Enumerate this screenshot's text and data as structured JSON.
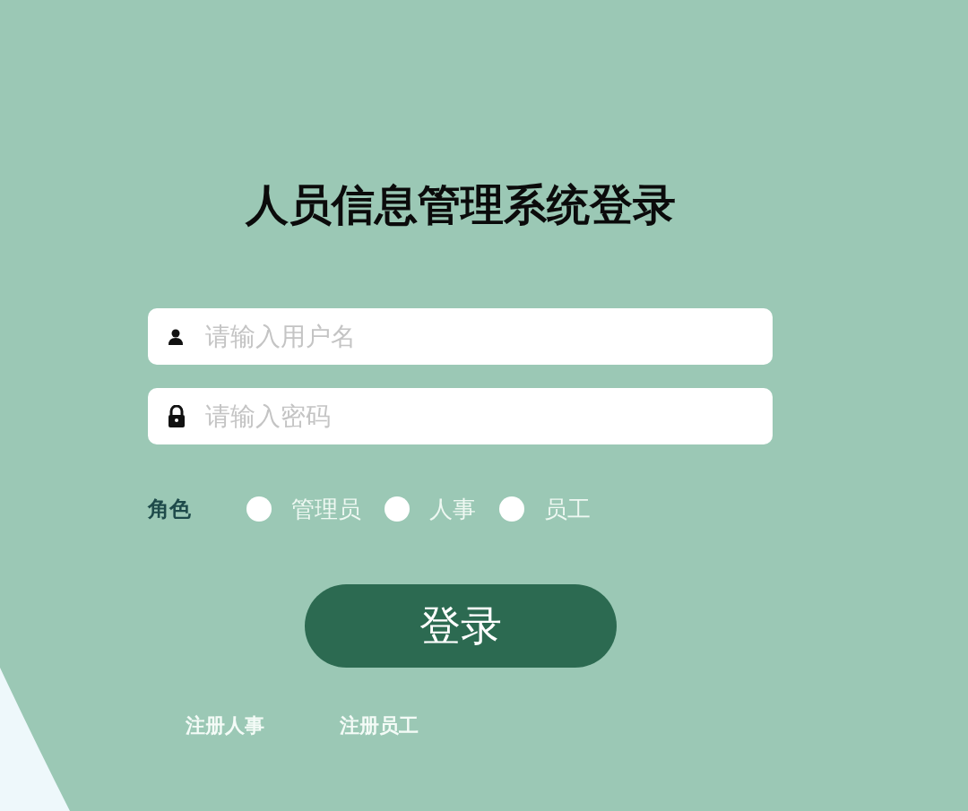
{
  "title": "人员信息管理系统登录",
  "fields": [
    {
      "kind": "user",
      "placeholder": "请输入用户名"
    },
    {
      "kind": "password",
      "placeholder": "请输入密码"
    }
  ],
  "role": {
    "label": "角色",
    "options": [
      {
        "label": "管理员",
        "selected": false
      },
      {
        "label": "人事",
        "selected": false
      },
      {
        "label": "员工",
        "selected": false
      }
    ]
  },
  "login_button": "登录",
  "links": [
    "注册人事",
    "注册员工"
  ]
}
